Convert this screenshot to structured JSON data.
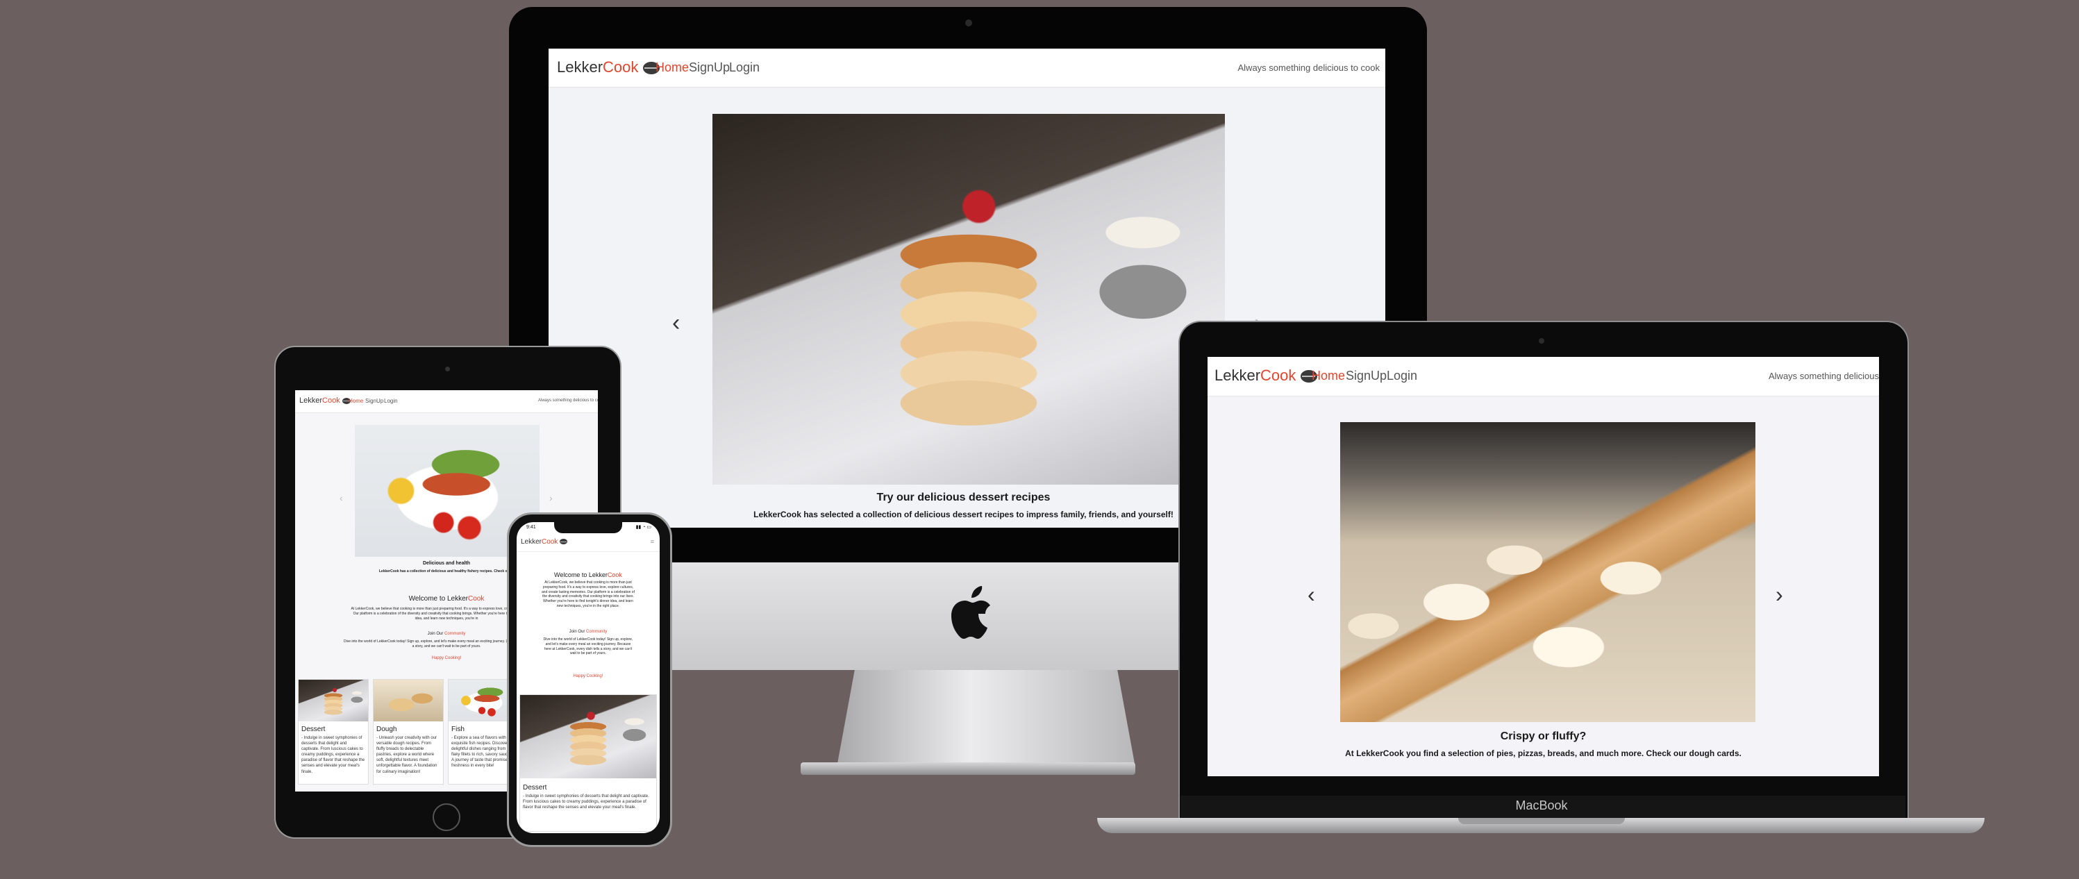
{
  "brand": {
    "name_prefix": "Lekker",
    "name_accent": "Cook",
    "accent_color": "#e0462e",
    "logo_icon": "pot-icon"
  },
  "nav": {
    "home": "Home",
    "signup": "SignUp",
    "login": "Login",
    "tagline": "Always something delicious to cook"
  },
  "desktop_site": {
    "slide_title": "Try our delicious dessert recipes",
    "slide_text": "LekkerCook has selected a collection of delicious dessert recipes to impress family, friends, and yourself!"
  },
  "laptop_site": {
    "slide_title": "Crispy or fluffy?",
    "slide_text": "At LekkerCook you find a selection of pies, pizzas, breads, and much more. Check our dough cards."
  },
  "laptop_label": "MacBook",
  "tablet_site": {
    "slide_title": "Delicious and health",
    "slide_text": "LekkerCook has a collection of delicious and healthy fishery recipes. Check our fi",
    "welcome_prefix": "Welcome to ",
    "welcome_brand_prefix": "Lekker",
    "welcome_brand_accent": "Cook",
    "intro": "At LekkerCook, we believe that cooking is more than just preparing food. It's a way to express love, create lasting memories. Our platform is a celebration of the diversity and creativity that cooking brings. Whether you're here to find tonight's dinner idea, and learn new techniques, you're in",
    "join_prefix": "Join Our ",
    "join_accent": "Community",
    "join_text": "Dive into the world of LekkerCook today! Sign up, explore, and let's make every meal an exciting journey. LekkerCook, every dish tells a story, and we can't wait to be part of yours.",
    "happy": "Happy Cooking!",
    "cards": [
      {
        "title": "Dessert",
        "text": "- Indulge in sweet symphonies of desserts that delight and captivate. From luscious cakes to creamy puddings, experience a paradise of flavor that reshape the senses and elevate your meal's finale."
      },
      {
        "title": "Dough",
        "text": "- Unleash your creativity with our versatile dough recipes. From fluffy breads to delectable pastries, explore a world where soft, delightful textures meet unforgettable flavor. A foundation for culinary imagination!"
      },
      {
        "title": "Fish",
        "text": "- Explore a sea of flavors with our exquisite fish recipes. Discover delightful dishes ranging from flaky fillets to rich, savory sauces. A journey of taste that promises freshness in every bite!"
      }
    ]
  },
  "phone_site": {
    "status_time": "9:41",
    "welcome_prefix": "Welcome to ",
    "welcome_brand_prefix": "Lekker",
    "welcome_brand_accent": "Cook",
    "intro": "At LekkerCook, we believe that cooking is more than just preparing food. It's a way to express love, explore cultures, and create lasting memories. Our platform is a celebration of the diversity and creativity that cooking brings into our lives. Whether you're here to find tonight's dinner idea, and learn new techniques, you're in the right place.",
    "join_prefix": "Join Our ",
    "join_accent": "Community",
    "join_text": "Dive into the world of LekkerCook today! Sign up, explore, and let's make every meal an exciting journey. Because here at LekkerCook, every dish tells a story, and we can't wait to be part of yours.",
    "happy": "Happy Cooking!",
    "card_title": "Dessert",
    "card_text": "- Indulge in sweet symphonies of desserts that delight and captivate. From luscious cakes to creamy puddings, experience a paradise of flavor that reshape the senses and elevate your meal's finale."
  }
}
